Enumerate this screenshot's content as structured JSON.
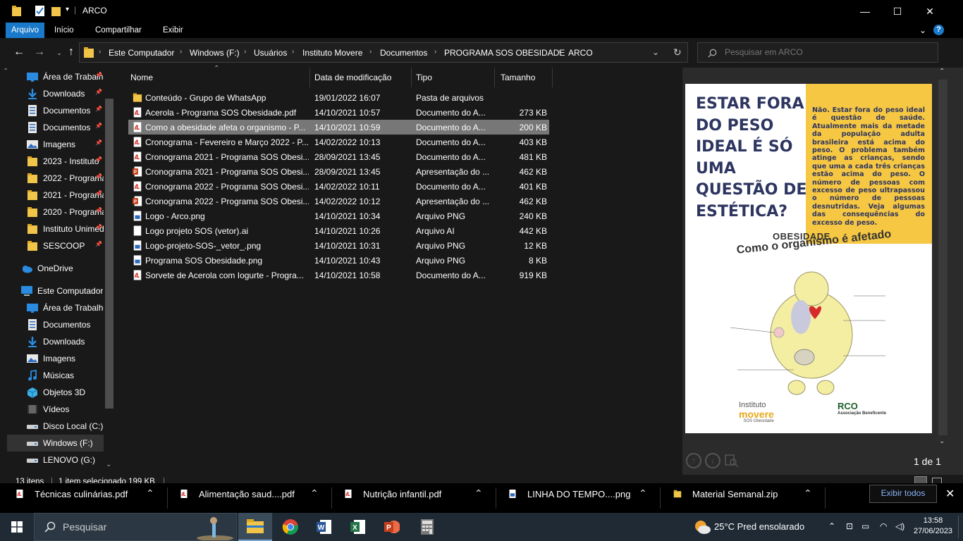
{
  "window": {
    "title": "ARCO",
    "minimize": "—",
    "maximize": "☐",
    "close": "✕"
  },
  "ribbon": {
    "tabs": [
      "Arquivo",
      "Início",
      "Compartilhar",
      "Exibir"
    ],
    "help": "?"
  },
  "address": {
    "breadcrumbs": [
      "Este Computador",
      "Windows (F:)",
      "Usuários",
      "Instituto Movere",
      "Documentos",
      "PROGRAMA SOS OBESIDADE",
      "ARCO"
    ]
  },
  "search": {
    "placeholder": "Pesquisar em ARCO"
  },
  "nav": {
    "items": [
      {
        "label": "Área de Trabalho",
        "icon": "desktop-icon",
        "pinned": true
      },
      {
        "label": "Downloads",
        "icon": "download-icon",
        "pinned": true
      },
      {
        "label": "Documentos",
        "icon": "document-icon",
        "pinned": true
      },
      {
        "label": "Documentos",
        "icon": "document-icon",
        "pinned": true
      },
      {
        "label": "Imagens",
        "icon": "image-icon",
        "pinned": true
      },
      {
        "label": "2023 - Instituto",
        "icon": "folder-icon",
        "pinned": true
      },
      {
        "label": "2022 - Programa",
        "icon": "folder-icon",
        "pinned": true
      },
      {
        "label": "2021 - Programa",
        "icon": "folder-icon",
        "pinned": true
      },
      {
        "label": "2020 - Programa",
        "icon": "folder-icon",
        "pinned": true
      },
      {
        "label": "Instituto Unimed",
        "icon": "folder-icon",
        "pinned": true
      },
      {
        "label": "SESCOOP",
        "icon": "folder-icon",
        "pinned": true
      },
      {
        "label": "OneDrive",
        "icon": "cloud-icon",
        "pinned": false
      },
      {
        "label": "Este Computador",
        "icon": "computer-icon",
        "pinned": false
      },
      {
        "label": "Área de Trabalho",
        "icon": "desktop-icon",
        "pinned": false
      },
      {
        "label": "Documentos",
        "icon": "document-icon",
        "pinned": false
      },
      {
        "label": "Downloads",
        "icon": "download-icon",
        "pinned": false
      },
      {
        "label": "Imagens",
        "icon": "image-icon",
        "pinned": false
      },
      {
        "label": "Músicas",
        "icon": "music-icon",
        "pinned": false
      },
      {
        "label": "Objetos 3D",
        "icon": "cube-icon",
        "pinned": false
      },
      {
        "label": "Vídeos",
        "icon": "video-icon",
        "pinned": false
      },
      {
        "label": "Disco Local (C:)",
        "icon": "drive-icon",
        "pinned": false
      },
      {
        "label": "Windows (F:)",
        "icon": "drive-icon",
        "pinned": false
      },
      {
        "label": "LENOVO (G:)",
        "icon": "drive-icon",
        "pinned": false
      }
    ]
  },
  "columns": [
    "Nome",
    "Data de modificação",
    "Tipo",
    "Tamanho"
  ],
  "files": [
    {
      "name": "Conteúdo - Grupo de WhatsApp",
      "date": "19/01/2022 16:07",
      "type": "Pasta de arquivos",
      "size": "",
      "icon": "folder-icon"
    },
    {
      "name": "Acerola - Programa SOS Obesidade.pdf",
      "date": "14/10/2021 10:57",
      "type": "Documento do A...",
      "size": "273 KB",
      "icon": "pdf-icon"
    },
    {
      "name": "Como a obesidade afeta o organismo - P...",
      "date": "14/10/2021 10:59",
      "type": "Documento do A...",
      "size": "200 KB",
      "icon": "pdf-icon"
    },
    {
      "name": "Cronograma - Fevereiro e Março 2022 - P...",
      "date": "14/02/2022 10:13",
      "type": "Documento do A...",
      "size": "403 KB",
      "icon": "pdf-icon"
    },
    {
      "name": "Cronograma 2021 - Programa SOS Obesi...",
      "date": "28/09/2021 13:45",
      "type": "Documento do A...",
      "size": "481 KB",
      "icon": "pdf-icon"
    },
    {
      "name": "Cronograma 2021 - Programa SOS Obesi...",
      "date": "28/09/2021 13:45",
      "type": "Apresentação do ...",
      "size": "462 KB",
      "icon": "powerpoint-icon"
    },
    {
      "name": "Cronograma 2022 - Programa SOS Obesi...",
      "date": "14/02/2022 10:11",
      "type": "Documento do A...",
      "size": "401 KB",
      "icon": "pdf-icon"
    },
    {
      "name": "Cronograma 2022 - Programa SOS Obesi...",
      "date": "14/02/2022 10:12",
      "type": "Apresentação do ...",
      "size": "462 KB",
      "icon": "powerpoint-icon"
    },
    {
      "name": "Logo - Arco.png",
      "date": "14/10/2021 10:34",
      "type": "Arquivo PNG",
      "size": "240 KB",
      "icon": "png-icon"
    },
    {
      "name": "Logo projeto SOS (vetor).ai",
      "date": "14/10/2021 10:26",
      "type": "Arquivo AI",
      "size": "442 KB",
      "icon": "ai-file-icon"
    },
    {
      "name": "Logo-projeto-SOS-_vetor_.png",
      "date": "14/10/2021 10:31",
      "type": "Arquivo PNG",
      "size": "12 KB",
      "icon": "png-icon"
    },
    {
      "name": "Programa SOS Obesidade.png",
      "date": "14/10/2021 10:43",
      "type": "Arquivo PNG",
      "size": "8 KB",
      "icon": "png-icon"
    },
    {
      "name": "Sorvete de Acerola com Iogurte - Progra...",
      "date": "14/10/2021 10:58",
      "type": "Documento do A...",
      "size": "919 KB",
      "icon": "pdf-icon"
    }
  ],
  "preview": {
    "heading": "ESTAR FORA DO PESO IDEAL É SÓ UMA QUESTÃO DE ESTÉTICA?",
    "body": "Não. Estar fora do peso ideal é questão de saúde. Atualmente mais da metade da população adulta brasileira está acima do peso. O problema também atinge as crianças, sendo que uma a cada três crianças estão acima do peso. O número de pessoas com excesso de peso ultrapassou o número de pessoas desnutridas. Veja algumas das consequências do excesso de peso.",
    "figure_title": "OBESIDADE",
    "figure_subtitle": "Como o organismo é afetado",
    "logo1_line1": "Instituto",
    "logo1_line2": "movere",
    "logo1_line3": "SOS Obesidade",
    "logo2_line1": "RCO",
    "logo2_line2": "Associação Beneficente",
    "page_count": "1 de 1"
  },
  "status": {
    "count": "13 itens",
    "selected": "1 item selecionado  199 KB"
  },
  "downloads": {
    "items": [
      "Técnicas culinárias.pdf",
      "Alimentação saud....pdf",
      "Nutrição infantil.pdf",
      "LINHA DO TEMPO....png",
      "Material Semanal.zip"
    ],
    "show_all": "Exibir todos"
  },
  "taskbar": {
    "search_placeholder": "Pesquisar",
    "weather": "25°C  Pred ensolarado",
    "time": "13:58",
    "date": "27/06/2023"
  },
  "colors": {
    "accent": "#1979ca",
    "selection": "#777777",
    "heading_navy": "#2d3560",
    "preview_yellow": "#f6c743"
  }
}
